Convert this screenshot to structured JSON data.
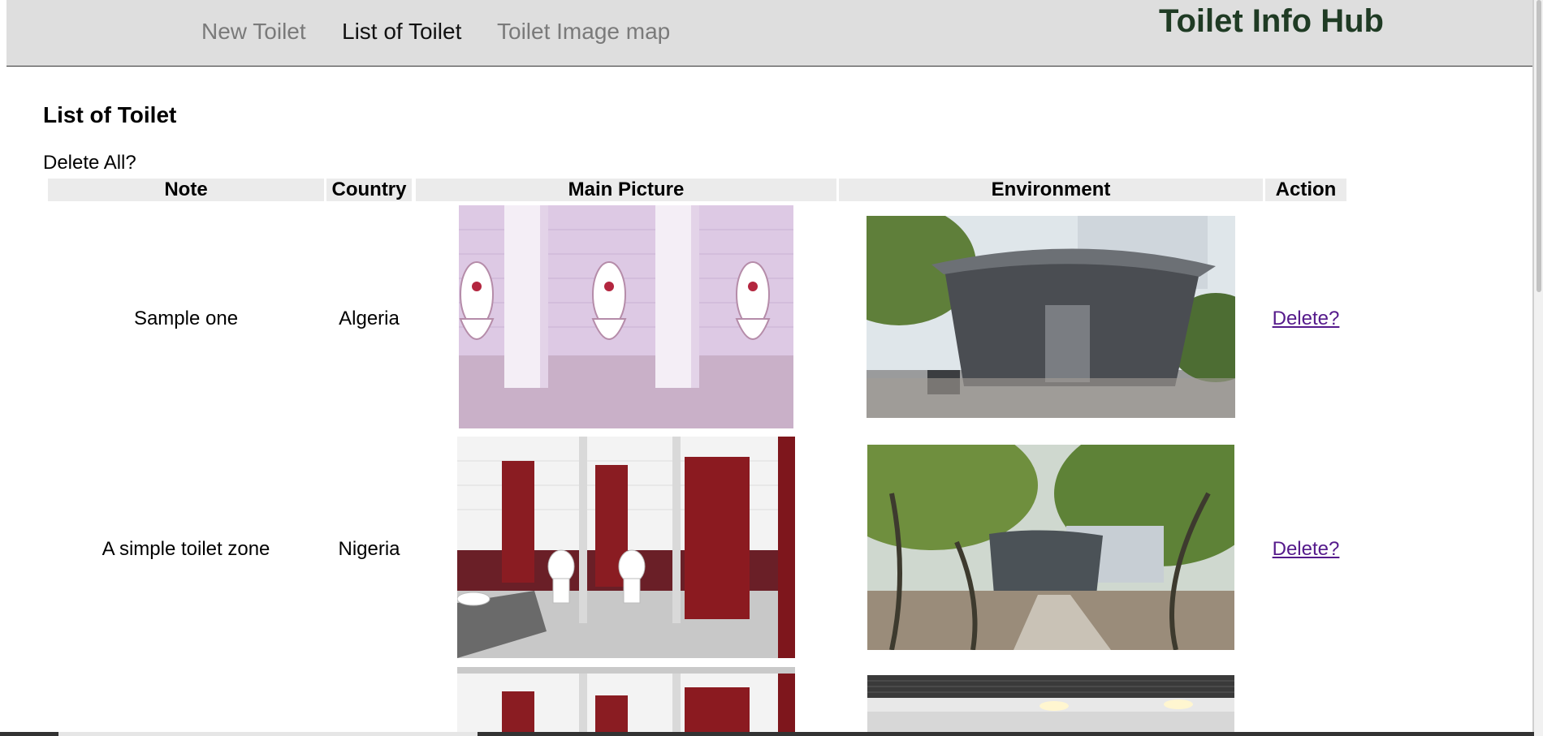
{
  "nav": {
    "items": [
      {
        "label": "New Toilet",
        "active": false
      },
      {
        "label": "List of Toilet",
        "active": true
      },
      {
        "label": "Toilet Image map",
        "active": false
      }
    ],
    "brand": "Toilet Info Hub"
  },
  "page": {
    "title": "List of Toilet",
    "delete_all": "Delete All?"
  },
  "table": {
    "headers": [
      "Note",
      "Country",
      "Main Picture",
      "Environment",
      "Action"
    ],
    "rows": [
      {
        "note": "Sample one",
        "country": "Algeria",
        "main_picture": "toilet-stalls-photo",
        "environment": "round-pavilion-toilet-photo",
        "action": "Delete?"
      },
      {
        "note": "A simple toilet zone",
        "country": "Nigeria",
        "main_picture": "red-door-restroom-photo",
        "environment": "park-pavilion-toilet-photo",
        "action": "Delete?"
      },
      {
        "note": "",
        "country": "",
        "main_picture": "red-door-restroom-photo",
        "environment": "ceiling-interior-photo",
        "action": ""
      }
    ]
  },
  "colors": {
    "topbar_bg": "#dedede",
    "brand": "#1f3b24",
    "nav_inactive": "#7a7a7a",
    "nav_active": "#111111",
    "header_bg": "#ebebeb",
    "visited_link": "#551a8b"
  }
}
